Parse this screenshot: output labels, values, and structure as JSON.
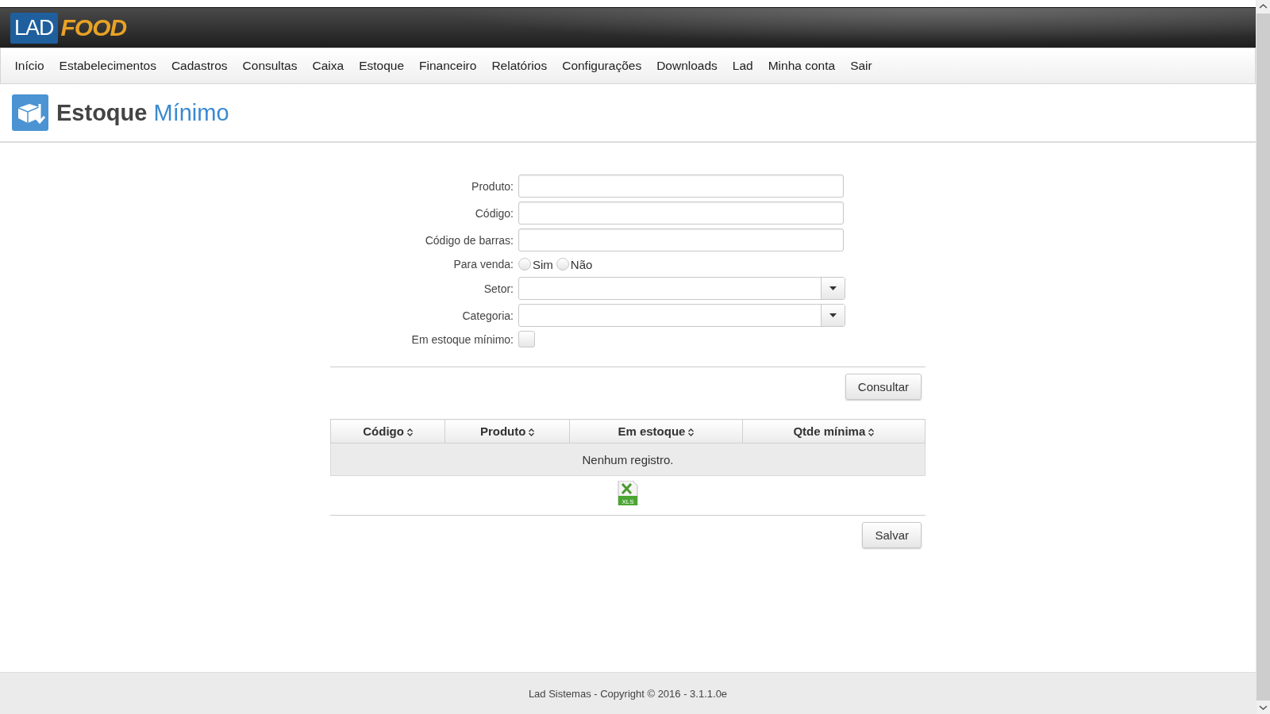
{
  "logo": {
    "part_1": "LAD",
    "part_2": "FOOD"
  },
  "nav": [
    "Início",
    "Estabelecimentos",
    "Cadastros",
    "Consultas",
    "Caixa",
    "Estoque",
    "Financeiro",
    "Relatórios",
    "Configurações",
    "Downloads",
    "Lad",
    "Minha conta",
    "Sair"
  ],
  "page": {
    "title": "Estoque",
    "title_accent": "Mínimo"
  },
  "form": {
    "fields": [
      {
        "kind": "text",
        "label": "Produto:"
      },
      {
        "kind": "text",
        "label": "Código:"
      },
      {
        "kind": "text",
        "label": "Código de barras:"
      },
      {
        "kind": "radio",
        "label": "Para venda:",
        "options": [
          {
            "label": "Sim",
            "selected": false
          },
          {
            "label": "Não",
            "selected": false
          }
        ]
      },
      {
        "kind": "select",
        "label": "Setor:"
      },
      {
        "kind": "select",
        "label": "Categoria:"
      },
      {
        "kind": "checkbox",
        "label": "Em estoque mínimo:",
        "checked": false
      }
    ]
  },
  "query_button": "Consultar",
  "table": {
    "columns": [
      "Código",
      "Produto",
      "Em estoque",
      "Qtde mínima"
    ],
    "empty_message": "Nenhum registro."
  },
  "export": {
    "label": "XLS"
  },
  "save_button": "Salvar",
  "footer": "Lad Sistemas - Copyright © 2016 - 3.1.1.0e"
}
